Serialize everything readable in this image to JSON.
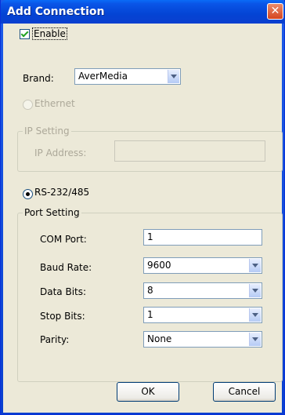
{
  "window": {
    "title": "Add Connection",
    "close_glyph": "✕"
  },
  "enable": {
    "label": "Enable",
    "checked": true
  },
  "brand": {
    "label": "Brand:",
    "value": "AverMedia"
  },
  "ethernet": {
    "radio_label": "Ethernet",
    "group_title": "IP Setting",
    "ip_label": "IP Address:",
    "ip_value": ""
  },
  "serial": {
    "radio_label": "RS-232/485",
    "group_title": "Port Setting",
    "fields": [
      {
        "label": "COM Port:",
        "value": "1"
      },
      {
        "label": "Baud Rate:",
        "value": "9600"
      },
      {
        "label": "Data Bits:",
        "value": "8"
      },
      {
        "label": "Stop Bits:",
        "value": "1"
      },
      {
        "label": "Parity:",
        "value": "None"
      }
    ]
  },
  "buttons": {
    "ok": "OK",
    "cancel": "Cancel"
  },
  "colors": {
    "titlebar": "#0a56e8",
    "dialog_bg": "#ece9d8",
    "close_button": "#d6451f",
    "disabled_text": "#aca899"
  }
}
